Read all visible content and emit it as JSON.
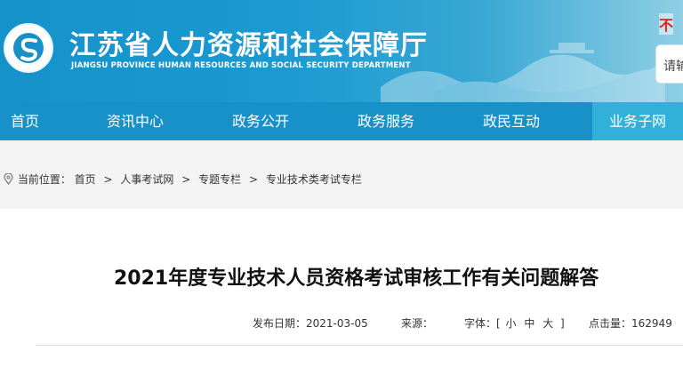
{
  "header": {
    "title": "江苏省人力资源和社会保障厅",
    "subtitle": "JIANGSU PROVINCE HUMAN RESOURCES AND SOCIAL SECURITY DEPARTMENT",
    "red_char": "不",
    "search_placeholder": "请输"
  },
  "nav": {
    "items": [
      {
        "label": "首页"
      },
      {
        "label": "资讯中心"
      },
      {
        "label": "政务公开"
      },
      {
        "label": "政务服务"
      },
      {
        "label": "政民互动"
      },
      {
        "label": "业务子网"
      }
    ]
  },
  "breadcrumb": {
    "prefix": "当前位置：",
    "items": [
      "首页",
      "人事考试网",
      "专题专栏",
      "专业技术类考试专栏"
    ],
    "separator": ">"
  },
  "article": {
    "title": "2021年度专业技术人员资格考试审核工作有关问题解答",
    "publish_label": "发布日期：",
    "publish_date": "2021-03-05",
    "source_label": "来源：",
    "font_label": "字体：[",
    "font_small": "小",
    "font_medium": "中",
    "font_large": "大",
    "font_close": "]",
    "views_label": "点击量：",
    "views": "162949"
  },
  "colors": {
    "header_blue": "#1592c9",
    "nav_blue": "#1890c8",
    "nav_active": "#31b0d9"
  }
}
